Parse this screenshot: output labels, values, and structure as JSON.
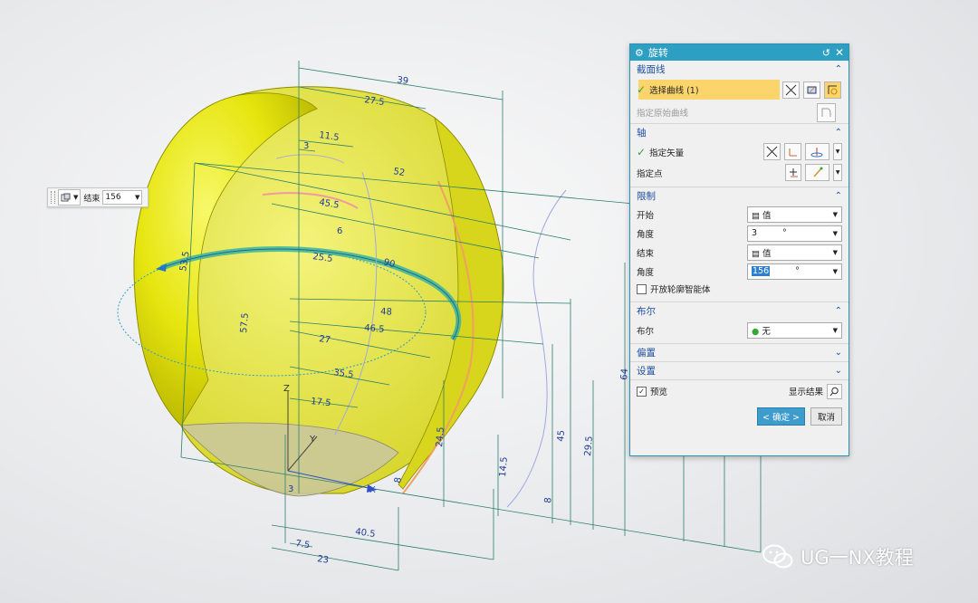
{
  "viewport": {
    "dimensions": [
      "39",
      "27.5",
      "11.5",
      "3",
      "52",
      "45.5",
      "25.5",
      "90",
      "53.5",
      "57.5",
      "48",
      "46.5",
      "27",
      "35.5",
      "17.5",
      "24.5",
      "14.5",
      "45",
      "29.5",
      "8",
      "64",
      "3",
      "40.5",
      "7.5",
      "23",
      "6",
      "8"
    ],
    "axis_labels": {
      "z": "Z",
      "y": "Y",
      "x": "X"
    }
  },
  "float_toolbar": {
    "label": "结束",
    "value": "156"
  },
  "dialog": {
    "title": "旋转",
    "sections": {
      "section_curve": {
        "title": "截面线",
        "select_curve": "选择曲线 (1)",
        "specify_origin": "指定原始曲线"
      },
      "axis": {
        "title": "轴",
        "specify_vector": "指定矢量",
        "specify_point": "指定点"
      },
      "limits": {
        "title": "限制",
        "start_label": "开始",
        "start_value": "值",
        "start_angle_label": "角度",
        "start_angle": "3",
        "start_unit": "°",
        "end_label": "结束",
        "end_value": "值",
        "end_angle_label": "角度",
        "end_angle": "156",
        "end_unit": "°",
        "open_profile": "开放轮廓智能体"
      },
      "boolean": {
        "title": "布尔",
        "label": "布尔",
        "value": "无"
      },
      "offset": {
        "title": "偏置"
      },
      "settings": {
        "title": "设置"
      }
    },
    "preview_label": "预览",
    "show_result": "显示结果",
    "ok": "< 确定 >",
    "cancel": "取消"
  },
  "watermark": {
    "text": "UG一NX教程"
  }
}
